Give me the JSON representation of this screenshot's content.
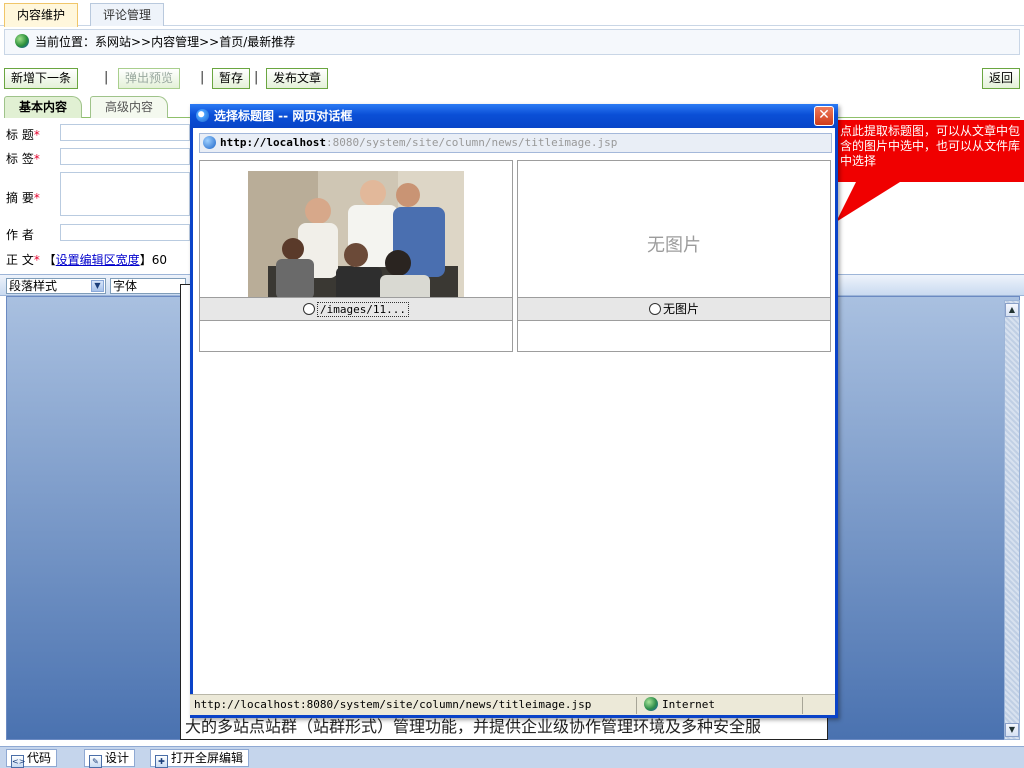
{
  "top_tabs": [
    {
      "label": "内容维护",
      "active": true
    },
    {
      "label": "评论管理",
      "active": false
    }
  ],
  "breadcrumb": {
    "text": "当前位置：系网站>>内容管理>>首页/最新推荐"
  },
  "toolbar": {
    "add_next_label": "新增下一条",
    "preview_label": "弹出预览",
    "save_draft_label": "暂存",
    "publish_label": "发布文章",
    "back_label": "返回",
    "separator": "|"
  },
  "section_tabs": [
    {
      "label": "基本内容",
      "active": true
    },
    {
      "label": "高级内容",
      "active": false
    }
  ],
  "form": {
    "title_label": "标 题",
    "tags_label": "标 签",
    "summary_label": "摘 要",
    "author_label": "作 者",
    "content_label": "正 文",
    "required_mark": "*",
    "bracket_open": "【",
    "bracket_close": "】",
    "editor_width_link": "设置编辑区宽度",
    "editor_width_value": "60"
  },
  "editor": {
    "paragraph_style": "段落样式",
    "font": "字体",
    "body_text": "大的多站点站群（站群形式）管理功能，并提供企业级协作管理环境及多种安全服"
  },
  "bottom_modes": [
    {
      "label": "代码"
    },
    {
      "label": "设计"
    },
    {
      "label": "打开全屏编辑"
    }
  ],
  "callout": {
    "text": "点此提取标题图，可以从文章中包含的图片中选中，也可以从文件库中选择",
    "bg_color": "#f00000"
  },
  "dialog": {
    "title": "选择标题图  --  网页对话框",
    "address_host": "http://localhost",
    "address_rest": ":8080/system/site/column/news/titleimage.jsp",
    "images": [
      {
        "caption": "/images/11...",
        "has_image": true
      },
      {
        "caption": "无图片",
        "has_image": false,
        "placeholder": "无图片"
      }
    ],
    "status_url": "http://localhost:8080/system/site/column/news/titleimage.jsp",
    "status_zone": "Internet",
    "close_symbol": "✕"
  }
}
